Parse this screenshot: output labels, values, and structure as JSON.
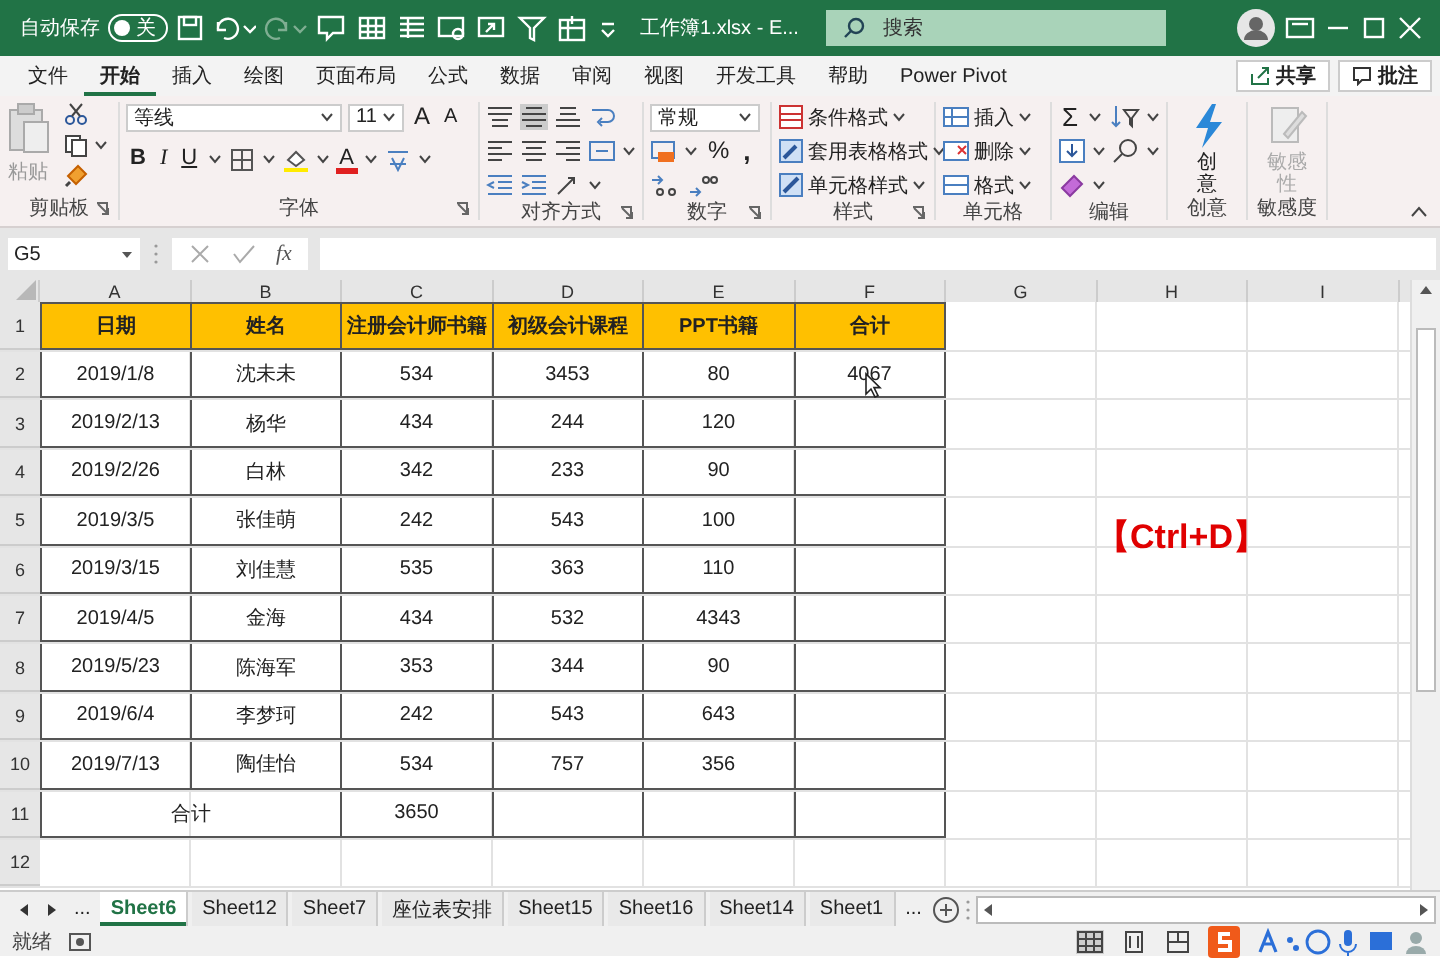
{
  "title_bar": {
    "autosave_label": "自动保存",
    "autosave": {
      "on": false,
      "state_text": "关"
    },
    "file_title": "工作簿1.xlsx - E...",
    "search": {
      "placeholder": "搜索"
    }
  },
  "ribbon_tabs": [
    {
      "label": "文件",
      "selected": false
    },
    {
      "label": "开始",
      "selected": true
    },
    {
      "label": "插入",
      "selected": false
    },
    {
      "label": "绘图",
      "selected": false
    },
    {
      "label": "页面布局",
      "selected": false
    },
    {
      "label": "公式",
      "selected": false
    },
    {
      "label": "数据",
      "selected": false
    },
    {
      "label": "审阅",
      "selected": false
    },
    {
      "label": "视图",
      "selected": false
    },
    {
      "label": "开发工具",
      "selected": false
    },
    {
      "label": "帮助",
      "selected": false
    },
    {
      "label": "Power Pivot",
      "selected": false
    }
  ],
  "share_button": "共享",
  "comments_button": "批注",
  "ribbon": {
    "clipboard": {
      "paste": "粘贴",
      "label": "剪贴板"
    },
    "font": {
      "font_name": "等线",
      "font_size": "11",
      "grow": "A",
      "shrink": "A",
      "bold": "B",
      "italic": "I",
      "underline": "U",
      "font_color": "A",
      "label": "字体"
    },
    "alignment": {
      "label": "对齐方式"
    },
    "number": {
      "format": "常规",
      "percent": "%",
      "comma": ",",
      "label": "数字"
    },
    "styles": {
      "items": [
        "条件格式",
        "套用表格格式",
        "单元格样式"
      ],
      "label": "样式"
    },
    "cells": {
      "items": [
        "插入",
        "删除",
        "格式"
      ],
      "label": "单元格"
    },
    "editing": {
      "sum": "Σ",
      "label": "编辑"
    },
    "ideas": {
      "button": "创意",
      "label": "创意"
    },
    "sensitivity": {
      "button": "敏感性",
      "label": "敏感度"
    }
  },
  "formula_bar": {
    "name_box": "G5",
    "fx": "fx"
  },
  "sheet": {
    "columns": [
      "A",
      "B",
      "C",
      "D",
      "E",
      "F",
      "G",
      "H",
      "I"
    ],
    "rows": [
      {
        "number": "1",
        "kind": "header",
        "cells": [
          "日期",
          "姓名",
          "注册会计师书籍",
          "初级会计课程",
          "PPT书籍",
          "合计"
        ]
      },
      {
        "number": "2",
        "kind": "data",
        "cells": [
          "2019/1/8",
          "沈未未",
          "534",
          "3453",
          "80",
          "4067"
        ]
      },
      {
        "number": "3",
        "kind": "data",
        "cells": [
          "2019/2/13",
          "杨华",
          "434",
          "244",
          "120",
          ""
        ]
      },
      {
        "number": "4",
        "kind": "data",
        "cells": [
          "2019/2/26",
          "白林",
          "342",
          "233",
          "90",
          ""
        ]
      },
      {
        "number": "5",
        "kind": "data",
        "cells": [
          "2019/3/5",
          "张佳萌",
          "242",
          "543",
          "100",
          ""
        ]
      },
      {
        "number": "6",
        "kind": "data",
        "cells": [
          "2019/3/15",
          "刘佳慧",
          "535",
          "363",
          "110",
          ""
        ]
      },
      {
        "number": "7",
        "kind": "data",
        "cells": [
          "2019/4/5",
          "金海",
          "434",
          "532",
          "4343",
          ""
        ]
      },
      {
        "number": "8",
        "kind": "data",
        "cells": [
          "2019/5/23",
          "陈海军",
          "353",
          "344",
          "90",
          ""
        ]
      },
      {
        "number": "9",
        "kind": "data",
        "cells": [
          "2019/6/4",
          "李梦珂",
          "242",
          "543",
          "643",
          ""
        ]
      },
      {
        "number": "10",
        "kind": "data",
        "cells": [
          "2019/7/13",
          "陶佳怡",
          "534",
          "757",
          "356",
          ""
        ]
      },
      {
        "number": "11",
        "kind": "total",
        "cells": [
          "合计",
          "",
          "3650",
          "",
          "",
          ""
        ]
      },
      {
        "number": "12",
        "kind": "empty",
        "cells": []
      }
    ]
  },
  "overlay_text": "【Ctrl+D】",
  "sheet_tabs": {
    "more": "...",
    "tabs": [
      {
        "label": "Sheet6",
        "selected": true
      },
      {
        "label": "Sheet12",
        "selected": false
      },
      {
        "label": "Sheet7",
        "selected": false
      },
      {
        "label": "座位表安排",
        "selected": false
      },
      {
        "label": "Sheet15",
        "selected": false
      },
      {
        "label": "Sheet16",
        "selected": false
      },
      {
        "label": "Sheet14",
        "selected": false
      },
      {
        "label": "Sheet1",
        "selected": false
      }
    ],
    "overflow": "..."
  },
  "status_bar": {
    "text": "就绪"
  }
}
